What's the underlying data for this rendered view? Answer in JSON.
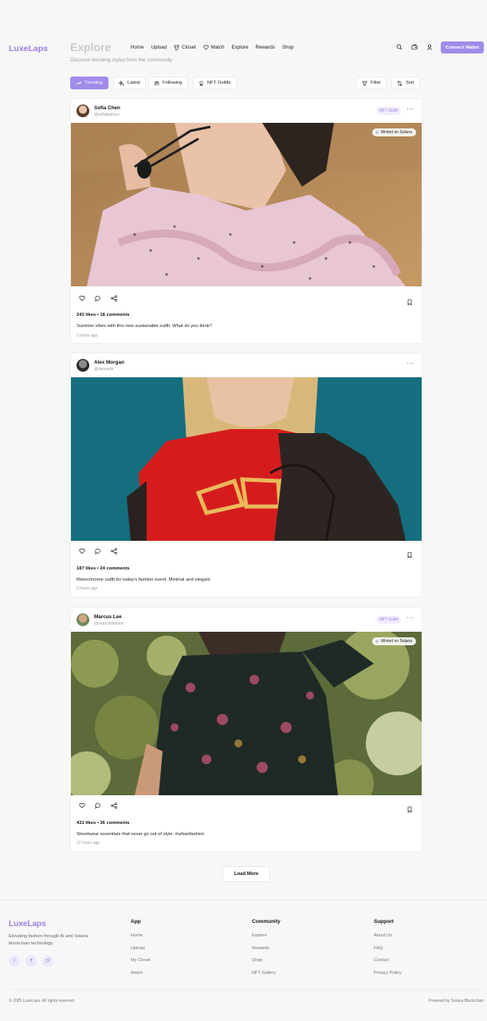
{
  "header": {
    "logo": "LuxeLaps",
    "page_title": "Explore",
    "subtitle": "Discover trending styles from the community",
    "nav": [
      {
        "label": "Home",
        "icon": "none"
      },
      {
        "label": "Upload",
        "icon": "none"
      },
      {
        "label": "Closet",
        "icon": "shirt-icon"
      },
      {
        "label": "Match",
        "icon": "heart-icon"
      },
      {
        "label": "Explore",
        "icon": "none"
      },
      {
        "label": "Rewards",
        "icon": "none"
      },
      {
        "label": "Shop",
        "icon": "none"
      }
    ],
    "connect_label": "Connect Wallet"
  },
  "filters": {
    "trending": "Trending",
    "latest": "Latest",
    "following": "Following",
    "nft": "NFT Outfits",
    "filter": "Filter",
    "sort": "Sort"
  },
  "posts": [
    {
      "name": "Sofia Chen",
      "handle": "@sofiafashion",
      "badge": "NFT Outfit",
      "minted": "Minted on Solana",
      "stats": "243 likes • 18 comments",
      "caption": "Summer vibes with this new sustainable outfit. What do you think?",
      "time": "2 hours ago"
    },
    {
      "name": "Alex Morgan",
      "handle": "@alexstyle",
      "badge": "",
      "minted": "",
      "stats": "187 likes • 24 comments",
      "caption": "Monochrome outfit for today's fashion event. Minimal and elegant.",
      "time": "5 hours ago"
    },
    {
      "name": "Marcus Lee",
      "handle": "@marcusfashion",
      "badge": "NFT Outfit",
      "minted": "Minted on Solana",
      "stats": "431 likes • 36 comments",
      "caption": "Streetwear essentials that never go out of style. #urbanfashion",
      "time": "12 hours ago"
    }
  ],
  "load_more": "Load More",
  "footer": {
    "logo": "LuxeLaps",
    "desc": "Elevating fashion through AI and Solana blockchain technology.",
    "socials": [
      "I",
      "T",
      "D"
    ],
    "columns": [
      {
        "title": "App",
        "links": [
          "Home",
          "Upload",
          "My Closet",
          "Match"
        ]
      },
      {
        "title": "Community",
        "links": [
          "Explore",
          "Rewards",
          "Shop",
          "NFT Gallery"
        ]
      },
      {
        "title": "Support",
        "links": [
          "About Us",
          "FAQ",
          "Contact",
          "Privacy Policy"
        ]
      }
    ],
    "copyright": "© 2025 LuxeLaps. All rights reserved.",
    "powered": "Powered by Solana Blockchain"
  },
  "colors": {
    "accent": "#a08be8",
    "brand": "#9b7ee0"
  }
}
